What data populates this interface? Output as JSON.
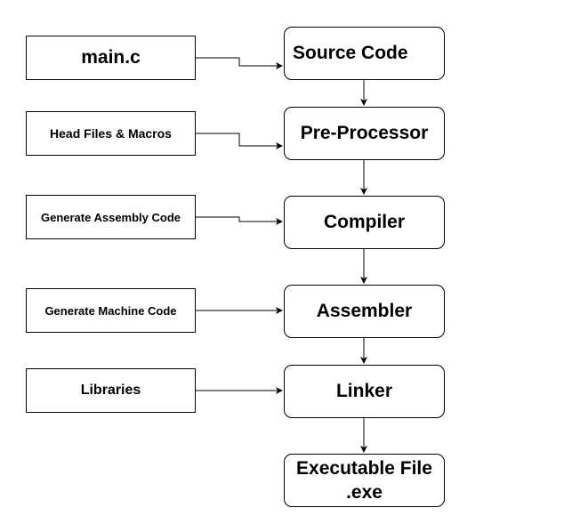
{
  "diagram": {
    "inputs": [
      {
        "label": "main.c"
      },
      {
        "label": "Head Files & Macros"
      },
      {
        "label": "Generate Assembly Code"
      },
      {
        "label": "Generate Machine Code"
      },
      {
        "label": "Libraries"
      }
    ],
    "stages": [
      {
        "label": "Source Code"
      },
      {
        "label": "Pre-Processor"
      },
      {
        "label": "Compiler"
      },
      {
        "label": "Assembler"
      },
      {
        "label": "Linker"
      },
      {
        "label": "Executable File\n.exe"
      }
    ]
  }
}
